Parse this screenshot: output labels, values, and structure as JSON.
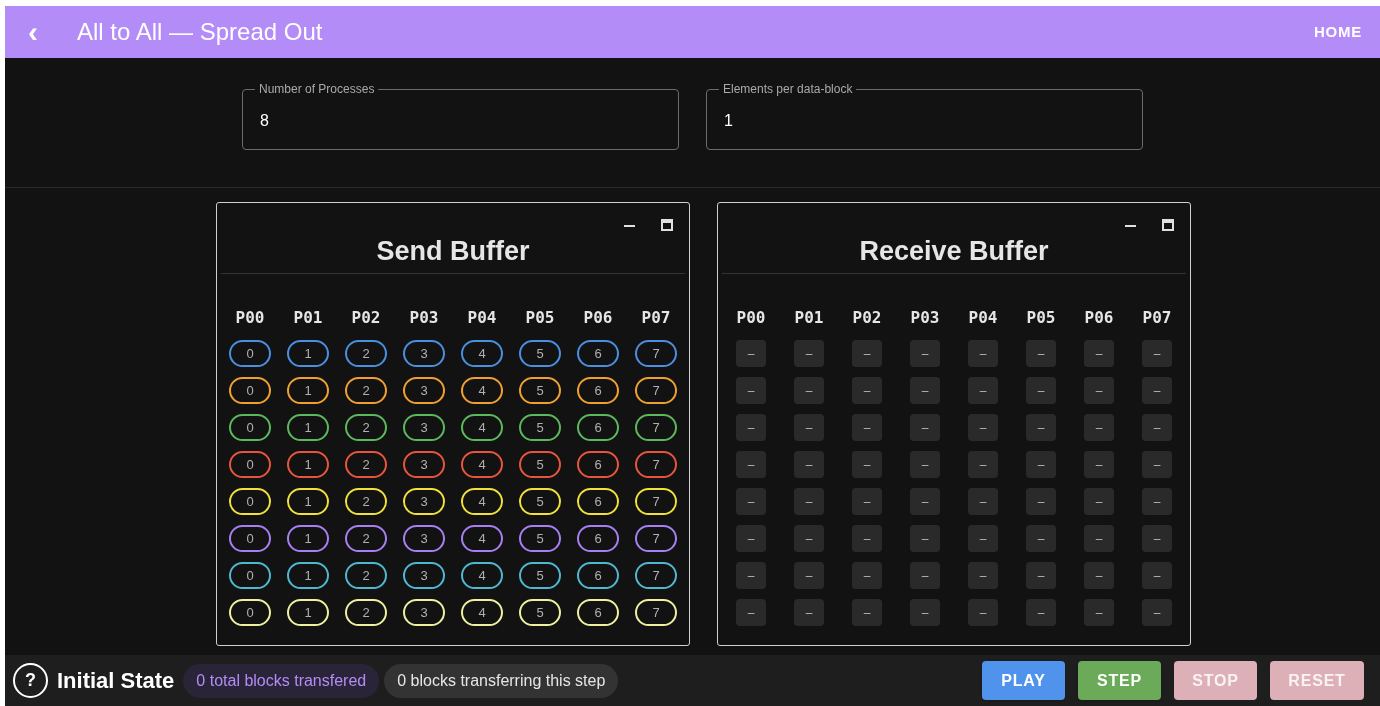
{
  "app_bar": {
    "back_icon": "‹",
    "title": "All to All — Spread Out",
    "home_link": "HOME"
  },
  "fields": [
    {
      "label": "Number of Processes",
      "value": "8"
    },
    {
      "label": "Elements per data-block",
      "value": "1"
    }
  ],
  "panels": [
    {
      "kind": "send",
      "title": "Send Buffer",
      "columns": [
        "P00",
        "P01",
        "P02",
        "P03",
        "P04",
        "P05",
        "P06",
        "P07"
      ],
      "rows": [
        {
          "color": "#4a90e2",
          "cells": [
            "0",
            "1",
            "2",
            "3",
            "4",
            "5",
            "6",
            "7"
          ]
        },
        {
          "color": "#f0a030",
          "cells": [
            "0",
            "1",
            "2",
            "3",
            "4",
            "5",
            "6",
            "7"
          ]
        },
        {
          "color": "#5cb85c",
          "cells": [
            "0",
            "1",
            "2",
            "3",
            "4",
            "5",
            "6",
            "7"
          ]
        },
        {
          "color": "#e8553e",
          "cells": [
            "0",
            "1",
            "2",
            "3",
            "4",
            "5",
            "6",
            "7"
          ]
        },
        {
          "color": "#f2e13a",
          "cells": [
            "0",
            "1",
            "2",
            "3",
            "4",
            "5",
            "6",
            "7"
          ]
        },
        {
          "color": "#a67ff0",
          "cells": [
            "0",
            "1",
            "2",
            "3",
            "4",
            "5",
            "6",
            "7"
          ]
        },
        {
          "color": "#4fb7d0",
          "cells": [
            "0",
            "1",
            "2",
            "3",
            "4",
            "5",
            "6",
            "7"
          ]
        },
        {
          "color": "#eef0a0",
          "cells": [
            "0",
            "1",
            "2",
            "3",
            "4",
            "5",
            "6",
            "7"
          ]
        }
      ]
    },
    {
      "kind": "receive",
      "title": "Receive Buffer",
      "columns": [
        "P00",
        "P01",
        "P02",
        "P03",
        "P04",
        "P05",
        "P06",
        "P07"
      ],
      "rows": [
        {
          "cells": [
            "–",
            "–",
            "–",
            "–",
            "–",
            "–",
            "–",
            "–"
          ]
        },
        {
          "cells": [
            "–",
            "–",
            "–",
            "–",
            "–",
            "–",
            "–",
            "–"
          ]
        },
        {
          "cells": [
            "–",
            "–",
            "–",
            "–",
            "–",
            "–",
            "–",
            "–"
          ]
        },
        {
          "cells": [
            "–",
            "–",
            "–",
            "–",
            "–",
            "–",
            "–",
            "–"
          ]
        },
        {
          "cells": [
            "–",
            "–",
            "–",
            "–",
            "–",
            "–",
            "–",
            "–"
          ]
        },
        {
          "cells": [
            "–",
            "–",
            "–",
            "–",
            "–",
            "–",
            "–",
            "–"
          ]
        },
        {
          "cells": [
            "–",
            "–",
            "–",
            "–",
            "–",
            "–",
            "–",
            "–"
          ]
        },
        {
          "cells": [
            "–",
            "–",
            "–",
            "–",
            "–",
            "–",
            "–",
            "–"
          ]
        }
      ]
    }
  ],
  "status_bar": {
    "help_icon": "?",
    "state": "Initial State",
    "chips": [
      {
        "kind": "accent",
        "text": "0 total blocks transfered"
      },
      {
        "kind": "plain",
        "text": "0 blocks transferring this step"
      }
    ],
    "buttons": [
      {
        "label": "PLAY",
        "color": "#4f93ec",
        "disabled": false
      },
      {
        "label": "STEP",
        "color": "#6aaa58",
        "disabled": false
      },
      {
        "label": "STOP",
        "color": "#dcb0b6",
        "disabled": true
      },
      {
        "label": "RESET",
        "color": "#dcb0b6",
        "disabled": true
      }
    ]
  }
}
